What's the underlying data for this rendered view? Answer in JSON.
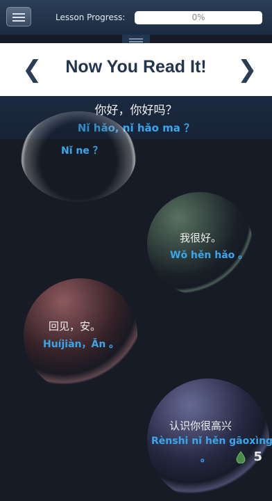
{
  "header": {
    "progress_label": "Lesson Progress:",
    "progress_text": "0%",
    "progress_value": 0
  },
  "title_panel": {
    "prev_arrow": "❮",
    "title": "Now You Read It!",
    "next_arrow": "❯"
  },
  "sentence": {
    "chinese": "你好，你好吗？",
    "pinyin": "Nǐ hǎo, nǐ hǎo ma ？"
  },
  "bubbles": [
    {
      "chinese": "",
      "pinyin": "Nǐ ne ？",
      "tint": "#c8c8c8"
    },
    {
      "chinese": "我很好。",
      "pinyin": "Wǒ hěn hǎo 。",
      "tint": "#9fcf9f"
    },
    {
      "chinese": "回见，安。",
      "pinyin": "Huíjiàn，Ān 。",
      "tint": "#e07a7a"
    },
    {
      "chinese": "认识你很高兴",
      "pinyin": "Rènshi nǐ hěn gāoxìng",
      "pinyin_tail": "。",
      "tint": "#9b9ee6"
    }
  ],
  "score": "5",
  "colors": {
    "background": "#161b25",
    "pinyin": "#3aa7ec",
    "title": "#21354e"
  }
}
